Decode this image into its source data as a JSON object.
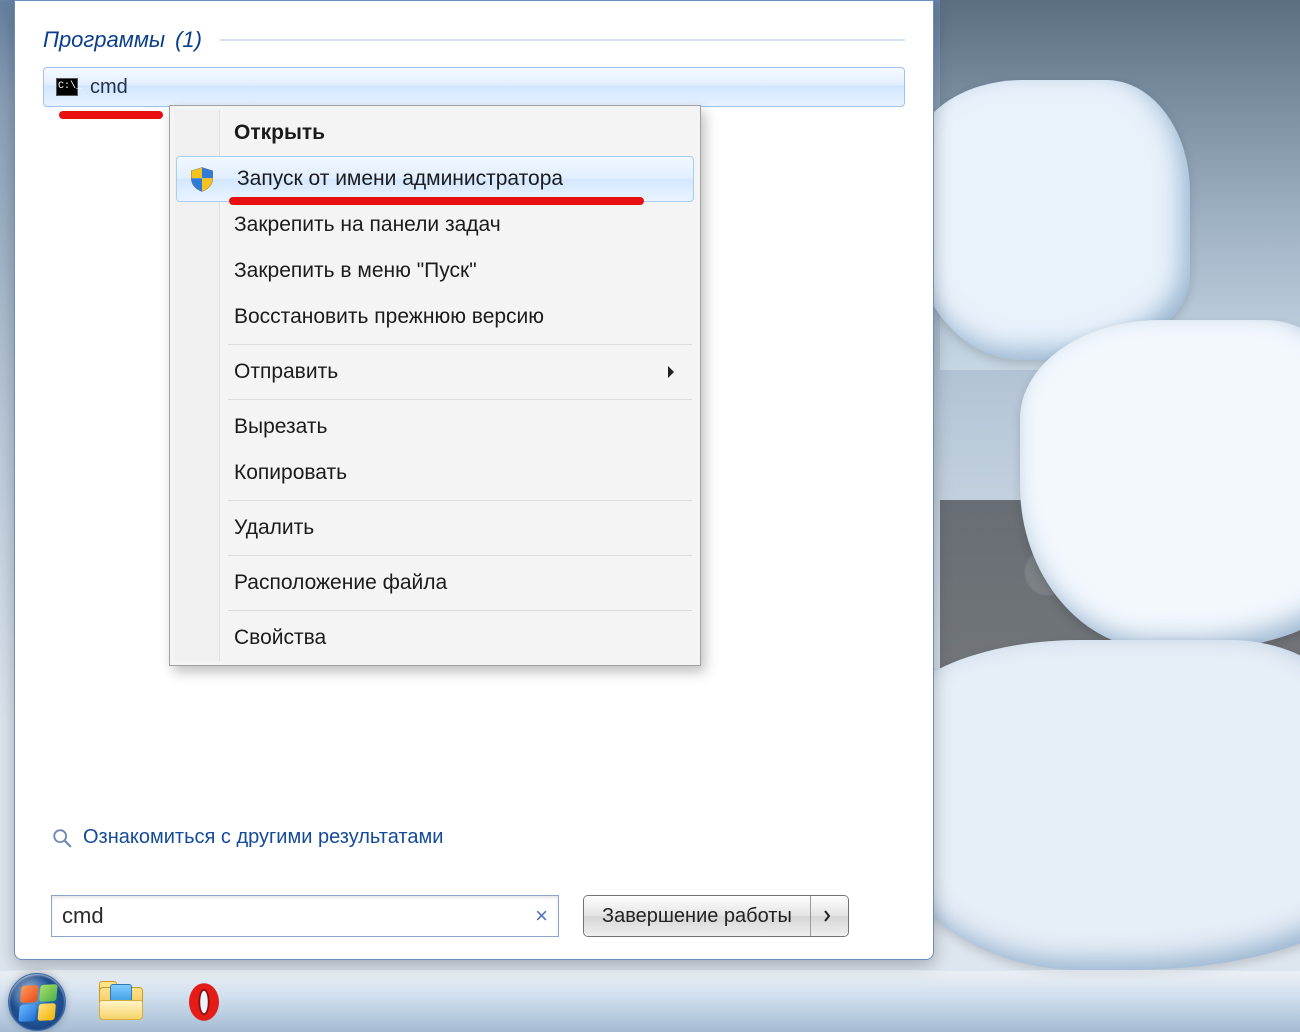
{
  "start_menu": {
    "category_label": "Программы",
    "category_count": "(1)",
    "result_label": "cmd",
    "more_results_label": "Ознакомиться с другими результатами",
    "search_value": "cmd",
    "shutdown_label": "Завершение работы"
  },
  "context_menu": {
    "items": [
      {
        "label": "Открыть",
        "bold": true
      },
      {
        "label": "Запуск от имени администратора",
        "icon": "shield",
        "hover": true
      },
      {
        "label": "Закрепить на панели задач"
      },
      {
        "label": "Закрепить в меню \"Пуск\""
      },
      {
        "label": "Восстановить прежнюю версию"
      },
      {
        "sep": true
      },
      {
        "label": "Отправить",
        "submenu": true
      },
      {
        "sep": true
      },
      {
        "label": "Вырезать"
      },
      {
        "label": "Копировать"
      },
      {
        "sep": true
      },
      {
        "label": "Удалить"
      },
      {
        "sep": true
      },
      {
        "label": "Расположение файла"
      },
      {
        "sep": true
      },
      {
        "label": "Свойства"
      }
    ]
  },
  "taskbar": {
    "start": "start-button",
    "explorer": "windows-explorer",
    "opera": "opera-browser"
  },
  "annotations": {
    "color": "#e70f0f"
  }
}
